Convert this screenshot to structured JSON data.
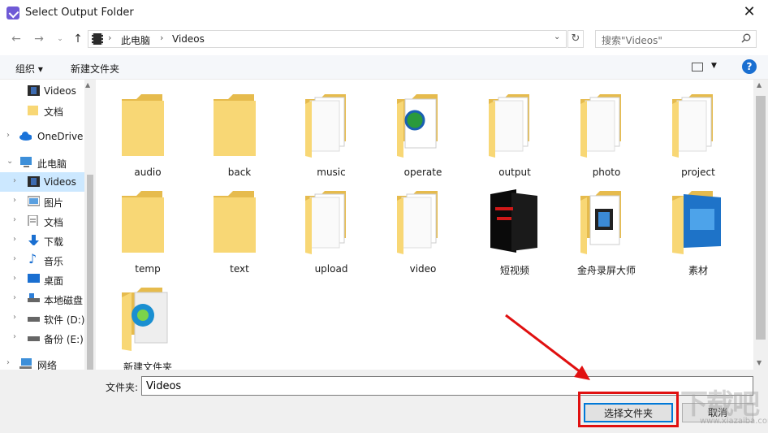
{
  "window": {
    "title": "Select Output Folder",
    "close_symbol": "✕"
  },
  "address": {
    "crumbs": [
      "此电脑",
      "Videos"
    ],
    "search_placeholder": "搜索\"Videos\""
  },
  "toolbar": {
    "organize": "组织 ▾",
    "new_folder": "新建文件夹",
    "help": "?"
  },
  "sidebar": {
    "items": [
      {
        "label": "Videos",
        "icon": "video-folder-icon"
      },
      {
        "label": "文档",
        "icon": "folder-icon"
      },
      {
        "label": "OneDrive",
        "icon": "cloud-icon"
      },
      {
        "label": "此电脑",
        "icon": "computer-icon"
      },
      {
        "label": "Videos",
        "icon": "video-folder-icon"
      },
      {
        "label": "图片",
        "icon": "pictures-icon"
      },
      {
        "label": "文档",
        "icon": "documents-icon"
      },
      {
        "label": "下载",
        "icon": "download-icon"
      },
      {
        "label": "音乐",
        "icon": "music-icon"
      },
      {
        "label": "桌面",
        "icon": "desktop-icon"
      },
      {
        "label": "本地磁盘",
        "icon": "drive-icon"
      },
      {
        "label": "软件 (D:)",
        "icon": "drive-icon"
      },
      {
        "label": "备份 (E:)",
        "icon": "drive-icon"
      },
      {
        "label": "网络",
        "icon": "network-icon"
      }
    ]
  },
  "files": [
    {
      "name": "audio",
      "kind": "empty"
    },
    {
      "name": "back",
      "kind": "empty"
    },
    {
      "name": "music",
      "kind": "doc"
    },
    {
      "name": "operate",
      "kind": "web"
    },
    {
      "name": "output",
      "kind": "doc"
    },
    {
      "name": "photo",
      "kind": "doc"
    },
    {
      "name": "project",
      "kind": "doc"
    },
    {
      "name": "temp",
      "kind": "empty"
    },
    {
      "name": "text",
      "kind": "empty"
    },
    {
      "name": "upload",
      "kind": "doc"
    },
    {
      "name": "video",
      "kind": "doc"
    },
    {
      "name": "短视频",
      "kind": "dark"
    },
    {
      "name": "金舟录屏大师",
      "kind": "film"
    },
    {
      "name": "素材",
      "kind": "blue"
    },
    {
      "name": "新建文件夹",
      "kind": "mp4"
    }
  ],
  "bottom": {
    "folder_label": "文件夹:",
    "folder_value": "Videos",
    "select_button": "选择文件夹",
    "cancel_button": "取消"
  },
  "watermark": {
    "text": "下载吧",
    "sub": "www.xiazaiba.com"
  },
  "colors": {
    "accent": "#0078d7",
    "highlight": "#e01010",
    "selection": "#cce8ff",
    "folder": "#f8d775"
  }
}
